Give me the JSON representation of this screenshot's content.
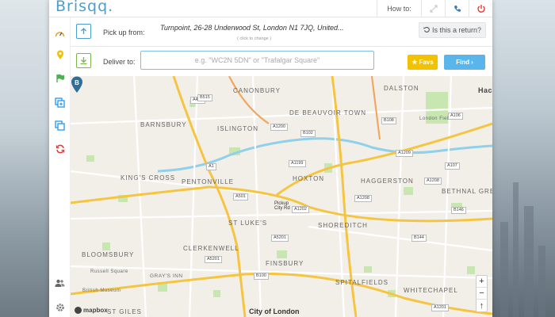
{
  "app": {
    "logo": "Brisqq",
    "logo_dot": ".",
    "howto_label": "How to:"
  },
  "pickup": {
    "label": "Pick up from:",
    "address": "Turnpoint, 26-28 Underwood St, London N1 7JQ, United...",
    "change_hint": "( click to change )",
    "return_label": "Is this a return?"
  },
  "deliver": {
    "label": "Deliver to:",
    "placeholder": "e.g. \"WC2N 5DN\" or \"Trafalgar Square\"",
    "favs_label": "Favs",
    "find_label": "Find"
  },
  "map": {
    "marker_letter": "B",
    "pickup_label_1": "Pickup",
    "pickup_label_2": "City Rd",
    "attribution": "mapbox",
    "districts": [
      "CANONBURY",
      "BARNSBURY",
      "ISLINGTON",
      "DE BEAUVOIR TOWN",
      "DALSTON",
      "KING'S CROSS",
      "PENTONVILLE",
      "HOXTON",
      "HAGGERSTON",
      "BETHNAL GREEN",
      "ST LUKE'S",
      "SHOREDITCH",
      "CLERKENWELL",
      "BLOOMSBURY",
      "FINSBURY",
      "SPITALFIELDS",
      "WHITECHAPEL",
      "ST GILES",
      "Hack",
      "London Fields",
      "Russell Square",
      "British Museum",
      "GRAY'S INN",
      "City of London"
    ],
    "roads": [
      "A1200",
      "A1208",
      "A1199",
      "B102",
      "B108",
      "A107",
      "A1",
      "A501",
      "A5201",
      "A1202",
      "A5201",
      "B100",
      "A401",
      "A1209",
      "A106",
      "B144",
      "B515",
      "A107",
      "A1208",
      "B146",
      "A1201",
      "A13"
    ],
    "zoom_in": "+",
    "zoom_out": "−",
    "compass": "↑"
  },
  "colors": {
    "brand": "#4a9fce",
    "favs": "#f2c200",
    "find": "#5ab6ea",
    "sidebar_orange": "#f0a020",
    "sidebar_yellow": "#f2c200",
    "sidebar_green": "#4caf50",
    "sidebar_blue": "#2196f3",
    "sidebar_red": "#e53935"
  },
  "icons": {
    "top": [
      "expand-icon",
      "phone-icon",
      "power-icon"
    ],
    "sidebar": [
      "speedometer-icon",
      "location-pin-icon",
      "flag-icon",
      "add-copy-icon",
      "copy-icon",
      "refresh-icon",
      "users-icon",
      "settings-icon"
    ]
  }
}
